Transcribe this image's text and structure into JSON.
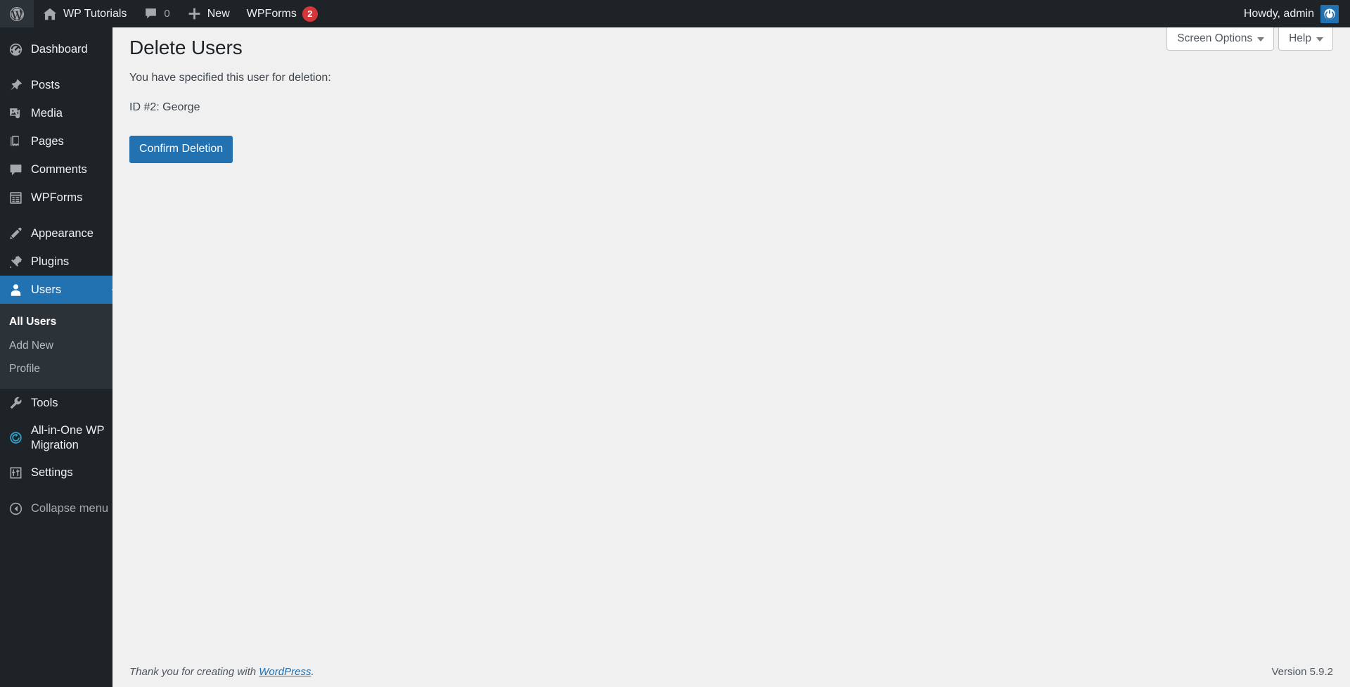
{
  "adminbar": {
    "wp_logo_name": "wordpress-logo-icon",
    "site_name": "WP Tutorials",
    "comments_count": "0",
    "new_label": "New",
    "wpforms_label": "WPForms",
    "wpforms_badge": "2",
    "howdy": "Howdy, admin",
    "accent_blue": "#2271b1",
    "badge_red": "#d63638"
  },
  "sidebar": {
    "items": [
      {
        "label": "Dashboard",
        "icon": "dashboard-icon",
        "current": false
      },
      {
        "label": "Posts",
        "icon": "pin-icon",
        "current": false
      },
      {
        "label": "Media",
        "icon": "media-icon",
        "current": false
      },
      {
        "label": "Pages",
        "icon": "pages-icon",
        "current": false
      },
      {
        "label": "Comments",
        "icon": "comments-icon",
        "current": false
      },
      {
        "label": "WPForms",
        "icon": "wpforms-icon",
        "current": false
      },
      {
        "label": "Appearance",
        "icon": "appearance-icon",
        "current": false
      },
      {
        "label": "Plugins",
        "icon": "plugins-icon",
        "current": false
      },
      {
        "label": "Users",
        "icon": "users-icon",
        "current": true
      },
      {
        "label": "Tools",
        "icon": "tools-icon",
        "current": false
      },
      {
        "label": "All-in-One WP Migration",
        "icon": "migration-icon",
        "current": false
      },
      {
        "label": "Settings",
        "icon": "settings-icon",
        "current": false
      }
    ],
    "users_submenu": [
      {
        "label": "All Users",
        "current": true
      },
      {
        "label": "Add New",
        "current": false
      },
      {
        "label": "Profile",
        "current": false
      }
    ],
    "collapse_label": "Collapse menu",
    "current_bg": "#2271b1",
    "bg": "#1d2327",
    "submenu_bg": "#2c3338"
  },
  "screen_meta": {
    "screen_options_label": "Screen Options",
    "help_label": "Help"
  },
  "main": {
    "page_title": "Delete Users",
    "intro_text": "You have specified this user for deletion:",
    "user_line": "ID #2: George",
    "confirm_button": "Confirm Deletion"
  },
  "footer": {
    "thanks_prefix": "Thank you for creating with ",
    "wordpress_link": "WordPress",
    "thanks_suffix": ".",
    "version": "Version 5.9.2"
  }
}
